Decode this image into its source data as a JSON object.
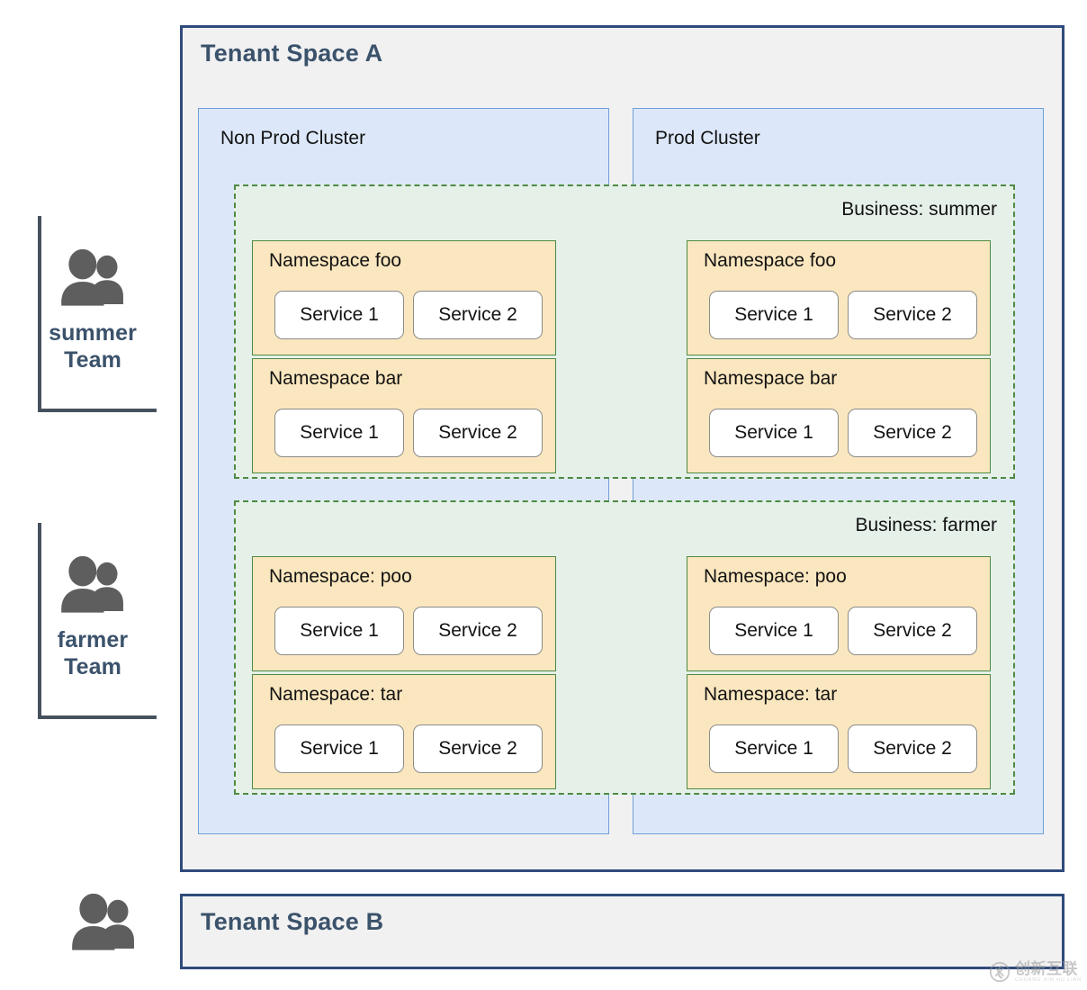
{
  "teams": [
    {
      "name_line1": "summer",
      "name_line2": "Team",
      "icon": "people-icon"
    },
    {
      "name_line1": "farmer",
      "name_line2": "Team",
      "icon": "people-icon"
    }
  ],
  "standalone_icon": {
    "icon": "people-icon"
  },
  "tenant_spaces": [
    {
      "title": "Tenant Space A",
      "clusters": [
        {
          "title": "Non Prod Cluster"
        },
        {
          "title": "Prod Cluster"
        }
      ],
      "businesses": [
        {
          "label": "Business: summer",
          "namespaces": [
            {
              "title": "Namespace foo",
              "services": [
                "Service 1",
                "Service 2"
              ]
            },
            {
              "title": "Namespace bar",
              "services": [
                "Service 1",
                "Service 2"
              ]
            },
            {
              "title": "Namespace foo",
              "services": [
                "Service 1",
                "Service 2"
              ]
            },
            {
              "title": "Namespace bar",
              "services": [
                "Service 1",
                "Service 2"
              ]
            }
          ]
        },
        {
          "label": "Business: farmer",
          "namespaces": [
            {
              "title": "Namespace: poo",
              "services": [
                "Service 1",
                "Service 2"
              ]
            },
            {
              "title": "Namespace: tar",
              "services": [
                "Service 1",
                "Service 2"
              ]
            },
            {
              "title": "Namespace: poo",
              "services": [
                "Service 1",
                "Service 2"
              ]
            },
            {
              "title": "Namespace: tar",
              "services": [
                "Service 1",
                "Service 2"
              ]
            }
          ]
        }
      ]
    },
    {
      "title": "Tenant Space B",
      "clusters": [],
      "businesses": []
    }
  ],
  "watermark": {
    "cn": "创新互联",
    "pinyin": "CHUANG XIN HU LIAN",
    "mark": "cx-logo-icon"
  },
  "colors": {
    "tenant_border": "#2f4b7c",
    "tenant_bg": "#f1f1f2",
    "cluster_bg": "#dce8f9",
    "cluster_border": "#6f9fd8",
    "business_bg": "#e5f0e9",
    "business_border": "#4e8a42",
    "namespace_bg": "#fbe7bf",
    "service_bg": "#ffffff",
    "title_text": "#3b526b",
    "team_bracket": "#46515e",
    "icon_fill": "#5e5e5e"
  }
}
